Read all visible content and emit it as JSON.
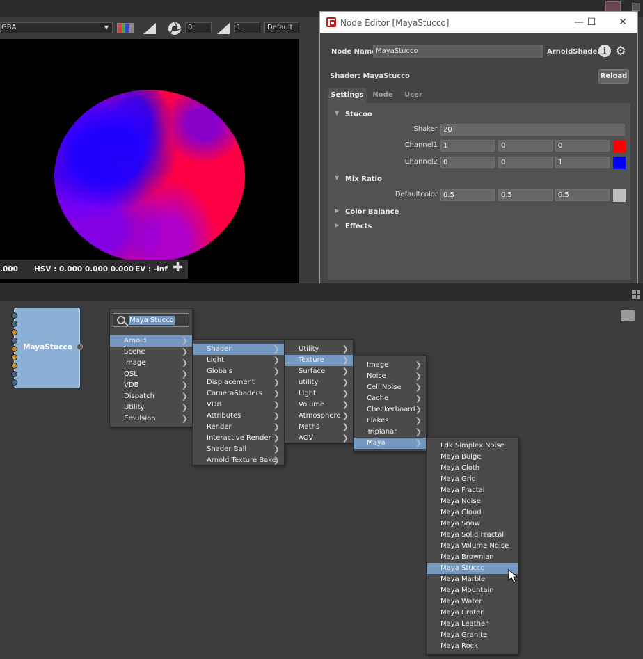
{
  "viewport": {
    "channel": "GBA",
    "exposure": "0",
    "gamma": "1",
    "lut": "Default",
    "status": {
      "rgb": ".000",
      "hsv": "HSV : 0.000 0.000 0.000",
      "ev": "EV : -inf"
    }
  },
  "node_editor": {
    "title": "Node Editor [MayaStucco]",
    "node_name_label": "Node Name",
    "node_name": "MayaStucco",
    "node_type": "ArnoldShader",
    "shader_label": "Shader: MayaStucco",
    "reload": "Reload",
    "tabs": [
      "Settings",
      "Node",
      "User"
    ],
    "sections": {
      "stucco": "Stucoo",
      "mix_ratio": "Mix Ratio",
      "color_balance": "Color Balance",
      "effects": "Effects"
    },
    "params": {
      "shaker": {
        "label": "Shaker",
        "value": "20"
      },
      "channel1": {
        "label": "Channel1",
        "values": [
          "1",
          "0",
          "0"
        ],
        "color": "#ff0000"
      },
      "channel2": {
        "label": "Channel2",
        "values": [
          "0",
          "0",
          "1"
        ],
        "color": "#0000ff"
      },
      "defaultcolor": {
        "label": "Defaultcolor",
        "values": [
          "0.5",
          "0.5",
          "0.5"
        ],
        "color": "#bfbfbf"
      }
    }
  },
  "graph": {
    "node_label": "MayaStucco",
    "search_text": "Maya Stucco",
    "menu1": [
      "Arnold",
      "Scene",
      "Image",
      "OSL",
      "VDB",
      "Dispatch",
      "Utility",
      "Emulsion"
    ],
    "menu2": [
      "Shader",
      "Light",
      "Globals",
      "Displacement",
      "CameraShaders",
      "VDB",
      "Attributes",
      "Render",
      "Interactive Render",
      "Shader Ball",
      "Arnold Texture Bake"
    ],
    "menu3": [
      "Utility",
      "Texture",
      "Surface",
      "utility",
      "Light",
      "Volume",
      "Atmosphere",
      "Maths",
      "AOV"
    ],
    "menu4": [
      "Image",
      "Noise",
      "Cell Noise",
      "Cache",
      "Checkerboard",
      "Flakes",
      "Triplanar",
      "Maya"
    ],
    "menu5": [
      "Ldk Simplex Noise",
      "Maya Bulge",
      "Maya Cloth",
      "Maya Grid",
      "Maya Fractal",
      "Maya Noise",
      "Maya Cloud",
      "Maya Snow",
      "Maya Solid Fractal",
      "Maya Volume Noise",
      "Maya Brownian",
      "Maya Stucco",
      "Maya Marble",
      "Maya Mountain",
      "Maya Water",
      "Maya Crater",
      "Maya Leather",
      "Maya Granite",
      "Maya Rock"
    ]
  }
}
